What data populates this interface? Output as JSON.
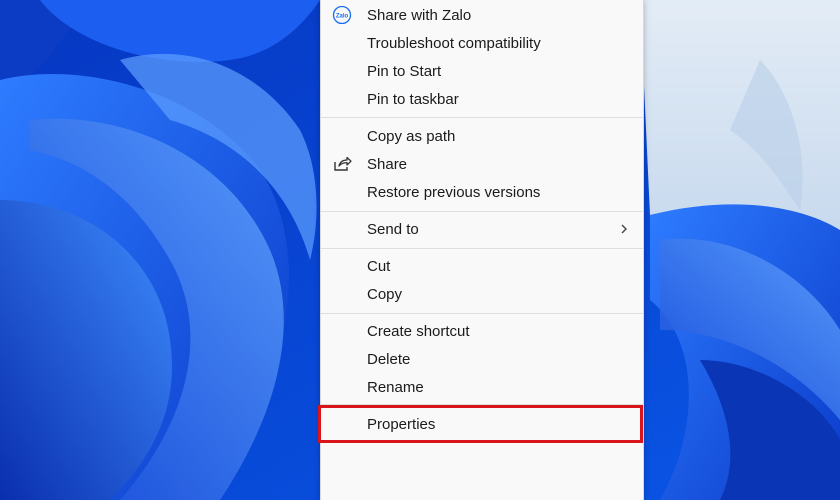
{
  "colors": {
    "menu_background": "#f9f9f9",
    "highlight_border": "#d9141b",
    "wallpaper_blue": "#0a3fd0"
  },
  "context_menu": {
    "groups": [
      [
        {
          "label": "Share with Zalo",
          "icon": "zalo-icon"
        },
        {
          "label": "Troubleshoot compatibility"
        },
        {
          "label": "Pin to Start"
        },
        {
          "label": "Pin to taskbar"
        }
      ],
      [
        {
          "label": "Copy as path"
        },
        {
          "label": "Share",
          "icon": "share-icon"
        },
        {
          "label": "Restore previous versions"
        }
      ],
      [
        {
          "label": "Send to",
          "submenu": "chevron-right-icon"
        }
      ],
      [
        {
          "label": "Cut"
        },
        {
          "label": "Copy"
        }
      ],
      [
        {
          "label": "Create shortcut"
        },
        {
          "label": "Delete"
        },
        {
          "label": "Rename"
        }
      ],
      [
        {
          "label": "Properties",
          "highlighted": true
        }
      ]
    ],
    "zalo_icon_text": "Zalo"
  }
}
